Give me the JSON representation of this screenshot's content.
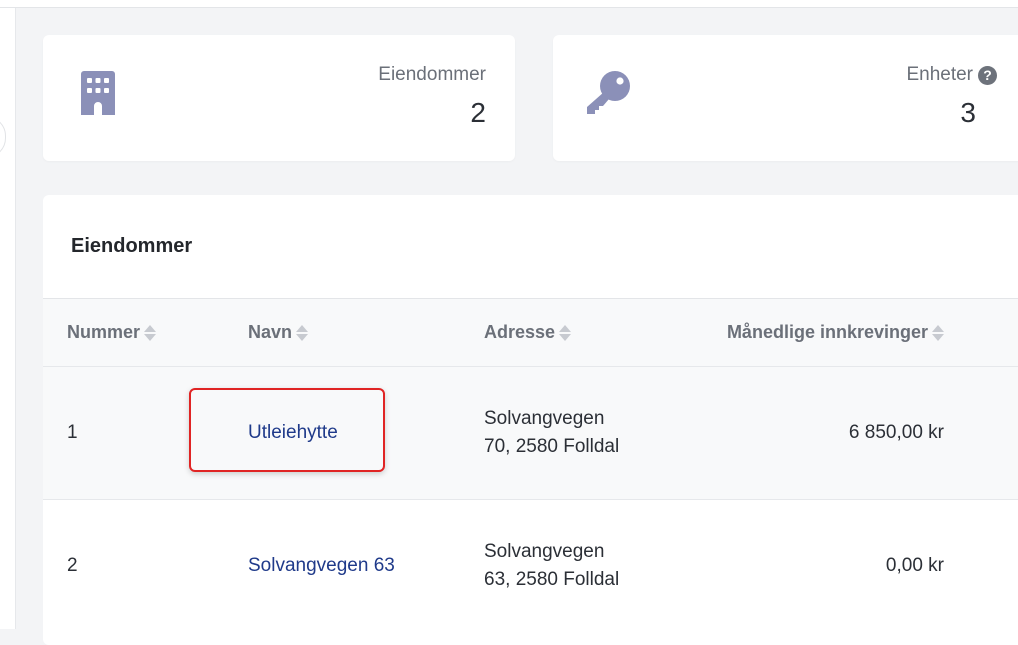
{
  "stats": {
    "properties": {
      "label": "Eiendommer",
      "value": "2",
      "icon": "building-icon"
    },
    "units": {
      "label": "Enheter",
      "value": "3",
      "icon": "key-icon",
      "help": "?"
    }
  },
  "table": {
    "title": "Eiendommer",
    "columns": {
      "number": "Nummer",
      "name": "Navn",
      "address": "Adresse",
      "monthly": "Månedlige innkrevinger"
    },
    "rows": [
      {
        "number": "1",
        "name": "Utleiehytte",
        "address": "Solvangvegen 70, 2580 Folldal",
        "monthly": "6 850,00 kr"
      },
      {
        "number": "2",
        "name": "Solvangvegen 63",
        "address": "Solvangvegen 63, 2580 Folldal",
        "monthly": "0,00 kr"
      }
    ]
  },
  "colors": {
    "icon": "#8b90b8",
    "link": "#1f3a8a",
    "highlight": "#e02424"
  }
}
